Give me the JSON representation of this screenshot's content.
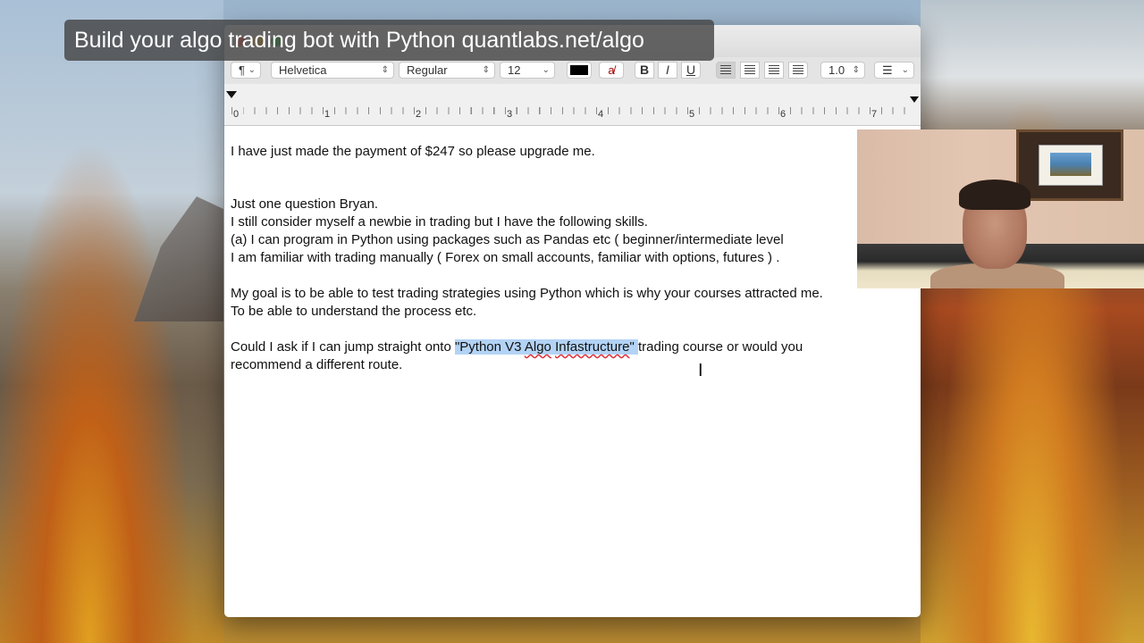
{
  "banner": {
    "text": "Build your algo trading bot with Python quantlabs.net/algo"
  },
  "toolbar": {
    "paragraph_style": "¶",
    "font_family": "Helvetica",
    "font_style": "Regular",
    "font_size": "12",
    "text_color": "#000000",
    "bold_label": "B",
    "italic_label": "I",
    "underline_label": "U",
    "line_spacing": "1.0"
  },
  "ruler": {
    "marks": [
      "0",
      "1",
      "2",
      "3",
      "4",
      "5",
      "6",
      "7"
    ]
  },
  "document": {
    "line1": "I have just  made the payment of $247 so please upgrade me.",
    "line2": "Just one question Bryan.",
    "line3": "I still consider myself a newbie in trading but I have the following skills.",
    "line4": "(a) I can program in Python using packages such as Pandas etc ( beginner/intermediate level",
    "line5": "I am familiar with trading manually ( Forex on small accounts, familiar with options, futures ) .",
    "line6": "My goal is to be able to test trading strategies using Python which is why your courses attracted me.",
    "line7": "To be able to understand the process etc.",
    "line8_pre": "Could I ask if I can jump straight onto ",
    "line8_sel_a": "\"Python V3 ",
    "line8_sel_algo": "Algo",
    "line8_sel_space": " ",
    "line8_sel_infa": "Infastructure",
    "line8_sel_end": "\" ",
    "line8_post": "trading course or would you",
    "line9": "recommend a different route."
  }
}
